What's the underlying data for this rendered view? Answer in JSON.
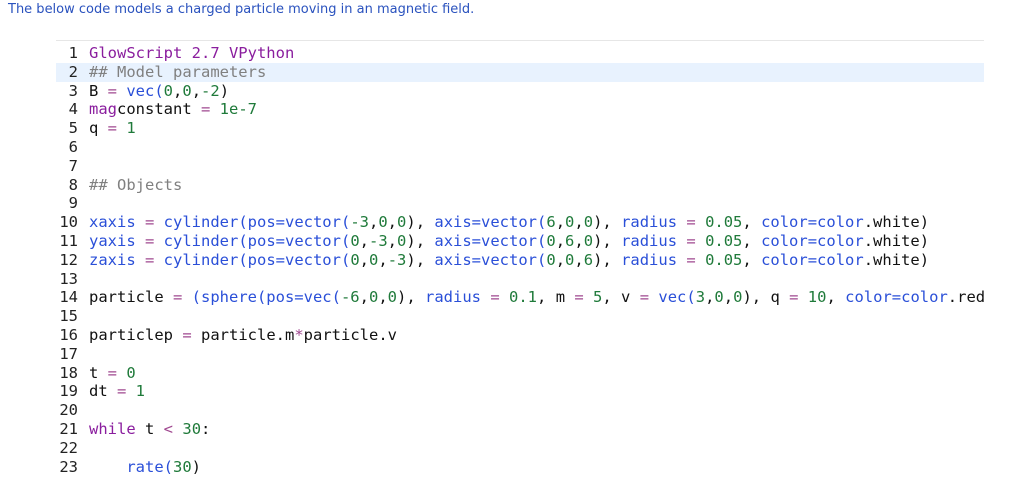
{
  "intro_text": "The below code models a charged particle moving in an magnetic field.",
  "colors": {
    "intro": "#2a52be",
    "keyword": "#8a1d9e",
    "function": "#2a4fd8",
    "number": "#1f7a3a",
    "operator": "#a04890",
    "comment": "#808080",
    "active_line_bg": "#e8f2fe"
  },
  "editor": {
    "active_line": 2,
    "lines": [
      {
        "n": "1",
        "tokens": [
          {
            "t": "GlowScript 2.7 VPython",
            "c": "kw"
          }
        ]
      },
      {
        "n": "2",
        "tokens": [
          {
            "t": "## Model parameters",
            "c": "cm"
          }
        ]
      },
      {
        "n": "3",
        "tokens": [
          {
            "t": "B",
            "c": "plain"
          },
          {
            "t": " = ",
            "c": "op"
          },
          {
            "t": "vec(",
            "c": "fn"
          },
          {
            "t": "0",
            "c": "num"
          },
          {
            "t": ",",
            "c": "plain"
          },
          {
            "t": "0",
            "c": "num"
          },
          {
            "t": ",",
            "c": "plain"
          },
          {
            "t": "-2",
            "c": "num"
          },
          {
            "t": ")",
            "c": "plain"
          }
        ]
      },
      {
        "n": "4",
        "tokens": [
          {
            "t": "mag",
            "c": "kw"
          },
          {
            "t": "constant",
            "c": "plain"
          },
          {
            "t": " = ",
            "c": "op"
          },
          {
            "t": "1e-7",
            "c": "num"
          }
        ]
      },
      {
        "n": "5",
        "tokens": [
          {
            "t": "q",
            "c": "plain"
          },
          {
            "t": " = ",
            "c": "op"
          },
          {
            "t": "1",
            "c": "num"
          }
        ]
      },
      {
        "n": "6",
        "tokens": []
      },
      {
        "n": "7",
        "tokens": []
      },
      {
        "n": "8",
        "tokens": [
          {
            "t": "## Objects",
            "c": "cm"
          }
        ]
      },
      {
        "n": "9",
        "tokens": []
      },
      {
        "n": "10",
        "tokens": [
          {
            "t": "xaxis",
            "c": "fn"
          },
          {
            "t": " = ",
            "c": "op"
          },
          {
            "t": "cylinder(pos=vector(",
            "c": "fn"
          },
          {
            "t": "-3",
            "c": "num"
          },
          {
            "t": ",",
            "c": "plain"
          },
          {
            "t": "0",
            "c": "num"
          },
          {
            "t": ",",
            "c": "plain"
          },
          {
            "t": "0",
            "c": "num"
          },
          {
            "t": "), ",
            "c": "plain"
          },
          {
            "t": "axis=vector(",
            "c": "fn"
          },
          {
            "t": "6",
            "c": "num"
          },
          {
            "t": ",",
            "c": "plain"
          },
          {
            "t": "0",
            "c": "num"
          },
          {
            "t": ",",
            "c": "plain"
          },
          {
            "t": "0",
            "c": "num"
          },
          {
            "t": "), ",
            "c": "plain"
          },
          {
            "t": "radius",
            "c": "fn"
          },
          {
            "t": " = ",
            "c": "op"
          },
          {
            "t": "0.05",
            "c": "num"
          },
          {
            "t": ", ",
            "c": "plain"
          },
          {
            "t": "color=color",
            "c": "fn"
          },
          {
            "t": ".white)",
            "c": "plain"
          }
        ]
      },
      {
        "n": "11",
        "tokens": [
          {
            "t": "yaxis",
            "c": "fn"
          },
          {
            "t": " = ",
            "c": "op"
          },
          {
            "t": "cylinder(pos=vector(",
            "c": "fn"
          },
          {
            "t": "0",
            "c": "num"
          },
          {
            "t": ",",
            "c": "plain"
          },
          {
            "t": "-3",
            "c": "num"
          },
          {
            "t": ",",
            "c": "plain"
          },
          {
            "t": "0",
            "c": "num"
          },
          {
            "t": "), ",
            "c": "plain"
          },
          {
            "t": "axis=vector(",
            "c": "fn"
          },
          {
            "t": "0",
            "c": "num"
          },
          {
            "t": ",",
            "c": "plain"
          },
          {
            "t": "6",
            "c": "num"
          },
          {
            "t": ",",
            "c": "plain"
          },
          {
            "t": "0",
            "c": "num"
          },
          {
            "t": "), ",
            "c": "plain"
          },
          {
            "t": "radius",
            "c": "fn"
          },
          {
            "t": " = ",
            "c": "op"
          },
          {
            "t": "0.05",
            "c": "num"
          },
          {
            "t": ", ",
            "c": "plain"
          },
          {
            "t": "color=color",
            "c": "fn"
          },
          {
            "t": ".white)",
            "c": "plain"
          }
        ]
      },
      {
        "n": "12",
        "tokens": [
          {
            "t": "zaxis",
            "c": "fn"
          },
          {
            "t": " = ",
            "c": "op"
          },
          {
            "t": "cylinder(pos=vector(",
            "c": "fn"
          },
          {
            "t": "0",
            "c": "num"
          },
          {
            "t": ",",
            "c": "plain"
          },
          {
            "t": "0",
            "c": "num"
          },
          {
            "t": ",",
            "c": "plain"
          },
          {
            "t": "-3",
            "c": "num"
          },
          {
            "t": "), ",
            "c": "plain"
          },
          {
            "t": "axis=vector(",
            "c": "fn"
          },
          {
            "t": "0",
            "c": "num"
          },
          {
            "t": ",",
            "c": "plain"
          },
          {
            "t": "0",
            "c": "num"
          },
          {
            "t": ",",
            "c": "plain"
          },
          {
            "t": "6",
            "c": "num"
          },
          {
            "t": "), ",
            "c": "plain"
          },
          {
            "t": "radius",
            "c": "fn"
          },
          {
            "t": " = ",
            "c": "op"
          },
          {
            "t": "0.05",
            "c": "num"
          },
          {
            "t": ", ",
            "c": "plain"
          },
          {
            "t": "color=color",
            "c": "fn"
          },
          {
            "t": ".white)",
            "c": "plain"
          }
        ]
      },
      {
        "n": "13",
        "tokens": []
      },
      {
        "n": "14",
        "tokens": [
          {
            "t": "particle",
            "c": "plain"
          },
          {
            "t": " = ",
            "c": "op"
          },
          {
            "t": "(sphere(pos=vec(",
            "c": "fn"
          },
          {
            "t": "-6",
            "c": "num"
          },
          {
            "t": ",",
            "c": "plain"
          },
          {
            "t": "0",
            "c": "num"
          },
          {
            "t": ",",
            "c": "plain"
          },
          {
            "t": "0",
            "c": "num"
          },
          {
            "t": "), ",
            "c": "plain"
          },
          {
            "t": "radius",
            "c": "fn"
          },
          {
            "t": " = ",
            "c": "op"
          },
          {
            "t": "0.1",
            "c": "num"
          },
          {
            "t": ", ",
            "c": "plain"
          },
          {
            "t": "m",
            "c": "plain"
          },
          {
            "t": " = ",
            "c": "op"
          },
          {
            "t": "5",
            "c": "num"
          },
          {
            "t": ", ",
            "c": "plain"
          },
          {
            "t": "v",
            "c": "plain"
          },
          {
            "t": " = ",
            "c": "op"
          },
          {
            "t": "vec(",
            "c": "fn"
          },
          {
            "t": "3",
            "c": "num"
          },
          {
            "t": ",",
            "c": "plain"
          },
          {
            "t": "0",
            "c": "num"
          },
          {
            "t": ",",
            "c": "plain"
          },
          {
            "t": "0",
            "c": "num"
          },
          {
            "t": "), ",
            "c": "plain"
          },
          {
            "t": "q",
            "c": "plain"
          },
          {
            "t": " = ",
            "c": "op"
          },
          {
            "t": "10",
            "c": "num"
          },
          {
            "t": ", ",
            "c": "plain"
          },
          {
            "t": "color=color",
            "c": "fn"
          },
          {
            "t": ".red))",
            "c": "plain"
          }
        ]
      },
      {
        "n": "15",
        "tokens": []
      },
      {
        "n": "16",
        "tokens": [
          {
            "t": "particlep",
            "c": "plain"
          },
          {
            "t": " = ",
            "c": "op"
          },
          {
            "t": "particle.m",
            "c": "plain"
          },
          {
            "t": "*",
            "c": "op"
          },
          {
            "t": "particle.v",
            "c": "plain"
          }
        ]
      },
      {
        "n": "17",
        "tokens": []
      },
      {
        "n": "18",
        "tokens": [
          {
            "t": "t",
            "c": "plain"
          },
          {
            "t": " = ",
            "c": "op"
          },
          {
            "t": "0",
            "c": "num"
          }
        ]
      },
      {
        "n": "19",
        "tokens": [
          {
            "t": "dt",
            "c": "plain"
          },
          {
            "t": " = ",
            "c": "op"
          },
          {
            "t": "1",
            "c": "num"
          }
        ]
      },
      {
        "n": "20",
        "tokens": []
      },
      {
        "n": "21",
        "tokens": [
          {
            "t": "while",
            "c": "kw"
          },
          {
            "t": " t ",
            "c": "plain"
          },
          {
            "t": "<",
            "c": "op"
          },
          {
            "t": " ",
            "c": "plain"
          },
          {
            "t": "30",
            "c": "num"
          },
          {
            "t": ":",
            "c": "plain"
          }
        ]
      },
      {
        "n": "22",
        "tokens": []
      },
      {
        "n": "23",
        "tokens": [
          {
            "t": "    rate(",
            "c": "fn"
          },
          {
            "t": "30",
            "c": "num"
          },
          {
            "t": ")",
            "c": "plain"
          }
        ]
      }
    ]
  }
}
